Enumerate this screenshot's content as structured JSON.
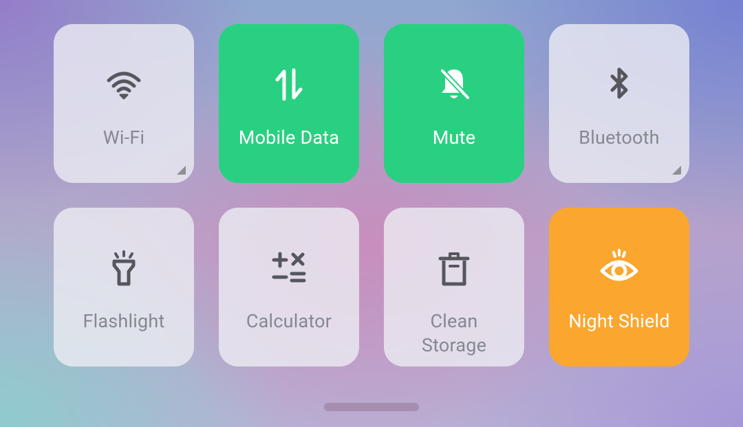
{
  "tiles": [
    {
      "label": "Wi-Fi",
      "icon": "wifi-icon",
      "state": "off",
      "has_corner": true
    },
    {
      "label": "Mobile Data",
      "icon": "mobile-data-icon",
      "state": "on"
    },
    {
      "label": "Mute",
      "icon": "mute-bell-icon",
      "state": "on"
    },
    {
      "label": "Bluetooth",
      "icon": "bluetooth-icon",
      "state": "off",
      "has_corner": true
    },
    {
      "label": "Flashlight",
      "icon": "flashlight-icon",
      "state": "off"
    },
    {
      "label": "Calculator",
      "icon": "calculator-icon",
      "state": "off"
    },
    {
      "label": "Clean\nStorage",
      "icon": "trash-icon",
      "state": "off"
    },
    {
      "label": "Night Shield",
      "icon": "eye-icon",
      "state": "on"
    }
  ],
  "colors": {
    "active_green": "#2ad081",
    "active_orange": "#fba62e",
    "inactive_tile": "#ececf2",
    "inactive_icon": "#55575d",
    "inactive_text": "#858890"
  }
}
